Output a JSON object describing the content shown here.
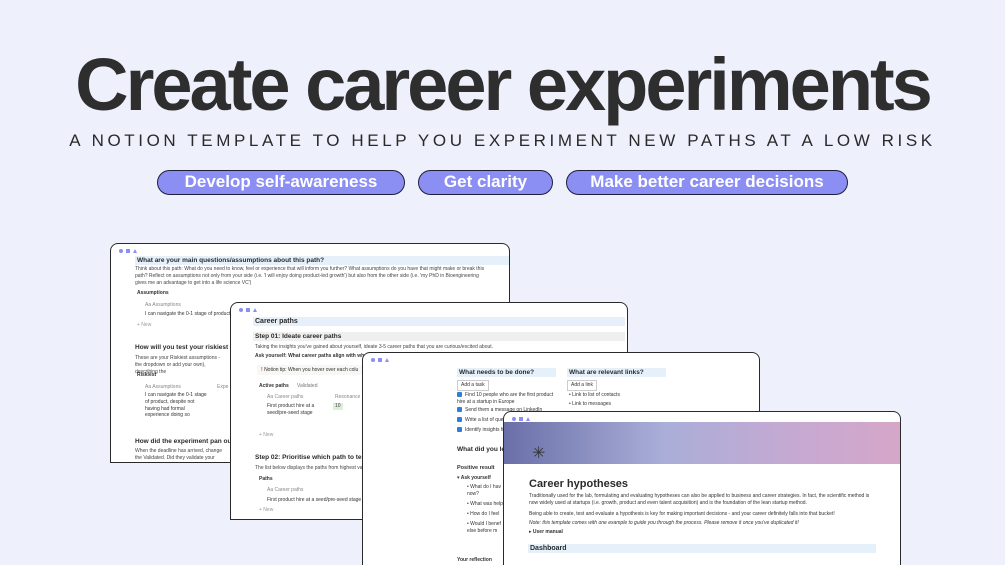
{
  "hero": {
    "title": "Create career experiments",
    "subtitle": "A NOTION TEMPLATE TO HELP YOU EXPERIMENT NEW PATHS AT A LOW RISK",
    "pills": [
      "Develop self-awareness",
      "Get clarity",
      "Make better career decisions"
    ]
  },
  "colors": {
    "background": "#eef0fc",
    "pill": "#8b8ef3",
    "accent": "#8b8ef3"
  },
  "window1": {
    "q1": "What are your main questions/assumptions about this path?",
    "q1_body": "Think about this path: What do you need to know, feel or experience that will inform you further? What assumptions do you have that might make or break this path? Reflect on assumptions not only from your side (i.e. 'I will enjoy doing product-led growth') but also from the other side (i.e. 'my PhD in Bioengineering gives me an advantage to get into a life science VC')",
    "assumptions_tab": "Assumptions",
    "assumptions_col": "Aa Assumptions",
    "assumption_item": "I can navigate the 0-1 stage of product,",
    "new": "+ New",
    "q2": "How will you test your riskiest assu",
    "q2_body": "These are your Riskiest assumptions - the dropdown or add your own), describing the",
    "riskiest_tab": "Riskiest",
    "riskiest_col": "Aa Assumptions",
    "riskiest_col2": "Expe",
    "riskiest_item": "I can navigate the 0-1 stage of product, despite not having had formal experience doing so",
    "q3": "How did the experiment pan out?",
    "q3_body": "When the deadline has arrived, change the Validated. Did they validate your assumption"
  },
  "window2": {
    "title": "Career paths",
    "step1": "Step 01: Ideate career paths",
    "step1_body": "Taking the insights you've gained about yourself, ideate 3-5 career paths that you are curious/excited about.",
    "ask": "Ask yourself: What career paths align with what",
    "tip": "Notion tip: When you hover over each colu",
    "tab_active": "Active paths",
    "tab_validated": "Validated",
    "col_paths": "Aa Career paths",
    "col_res": "Resonance",
    "path_item": "First product hire at a seed/pre-seed stage",
    "res_val": "10",
    "new": "+ New",
    "step2": "Step 02: Prioritise which path to test",
    "step2_body": "The list below displays the paths from highest valu",
    "paths_tab": "Paths",
    "col_paths2": "Aa Career paths",
    "path_item2": "First product hire at a seed/pre-seed stage",
    "new2": "+ New"
  },
  "window3": {
    "todo_title": "What needs to be done?",
    "add_task": "Add a task",
    "tasks": [
      "Find 10 people who are the first product hire at a startup in Europe",
      "Send them a message on LinkedIn",
      "Write a list of questions",
      "Identify insights from"
    ],
    "links_title": "What are relevant links?",
    "add_link": "Add a link",
    "links": [
      "Link to list of contacts",
      "Link to messages"
    ],
    "learn_title": "What did you le",
    "positive": "Positive result",
    "ask": "Ask yourself",
    "bullets": [
      "What do I hav now?",
      "What was help",
      "How do I feel",
      "Would I benef else before m"
    ],
    "reflection": "Your reflection"
  },
  "window4": {
    "title": "Career hypotheses",
    "p1": "Traditionally used for the lab, formulating and evaluating hypotheses can also be applied to business and career strategies. In fact, the scientific method is now widely used at startups (i.e. growth, product and even talent acquisition) and is the foundation of the lean startup method.",
    "p2": "Being able to create, test and evaluate a hypothesis is key for making important decisions - and your career definitely falls into that bucket!",
    "p3": "Note: this template comes with one example to guide you through the process. Please remove it once you've duplicated it!",
    "manual": "User manual",
    "dashboard": "Dashboard"
  }
}
